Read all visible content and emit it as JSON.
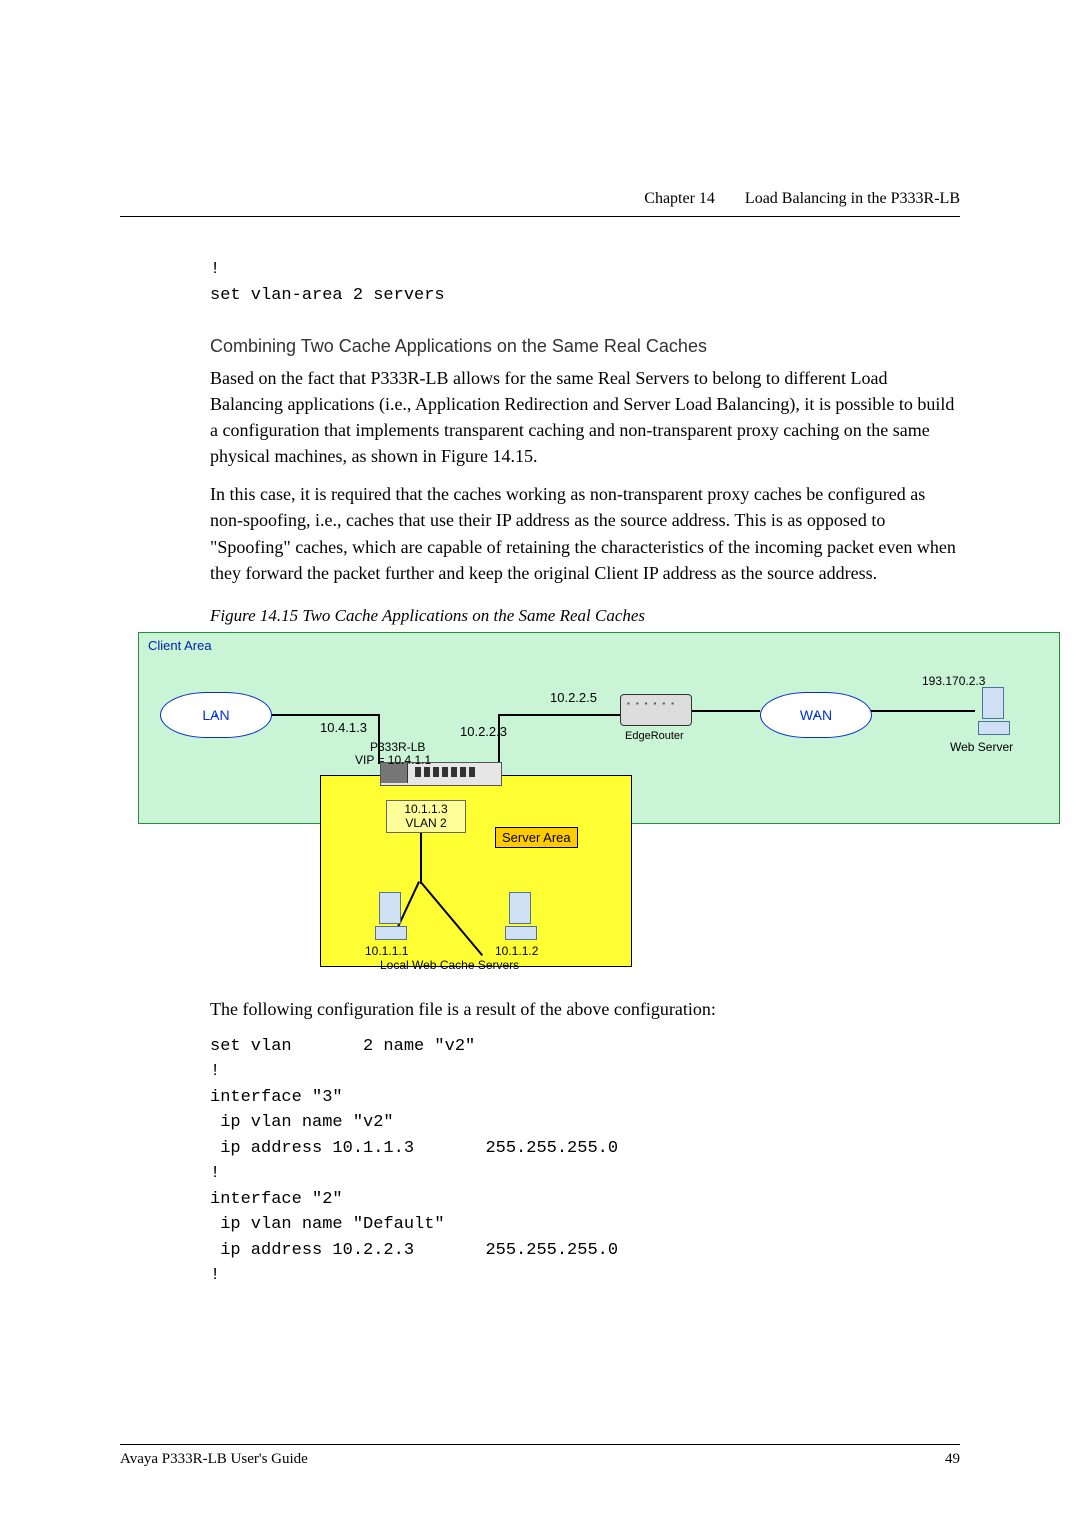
{
  "header": {
    "chapter": "Chapter 14",
    "title": "Load Balancing in the P333R-LB"
  },
  "code_top": "!\nset vlan-area 2 servers",
  "subheading": "Combining Two Cache Applications on the Same Real Caches",
  "para1": "Based on the fact that P333R-LB allows for the same Real Servers to belong to different Load Balancing applications (i.e., Application Redirection and Server Load Balancing), it is possible to build a configuration that implements transparent caching and non-transparent proxy caching on the same physical machines, as shown in Figure 14.15.",
  "para2": "In this case, it is required that the caches working as non-transparent proxy caches be configured as non-spoofing, i.e., caches that use their IP address as the source address. This is as opposed to \"Spoofing\" caches, which are capable of retaining the characteristics of the incoming packet even when they forward the packet further and keep the original Client IP address as the source address.",
  "fig_caption": "Figure 14.15  Two Cache Applications on the Same Real Caches",
  "diagram": {
    "client_area": "Client Area",
    "lan": "LAN",
    "wan": "WAN",
    "ip_10225": "10.2.2.5",
    "ip_10413": "10.4.1.3",
    "ip_10223": "10.2.2.3",
    "edge_router": "EdgeRouter",
    "p333r": "P333R-LB",
    "vip": "VIP = 10.4.1.1",
    "vlan_ip": "10.1.1.3",
    "vlan2": "VLAN 2",
    "server_area": "Server Area",
    "cache1": "10.1.1.1",
    "cache2": "10.1.1.2",
    "caches_label": "Local Web Cache Servers",
    "webserver_ip": "193.170.2.3",
    "web_server": "Web Server"
  },
  "para3": "The following configuration file is a result of the above configuration:",
  "code_bottom": "set vlan       2 name \"v2\"\n!\ninterface \"3\"\n ip vlan name \"v2\"\n ip address 10.1.1.3       255.255.255.0\n!\ninterface \"2\"\n ip vlan name \"Default\"\n ip address 10.2.2.3       255.255.255.0\n!",
  "footer": {
    "left": "Avaya P333R-LB User's Guide",
    "right": "49"
  },
  "chart_data": {
    "type": "diagram",
    "description": "Network topology showing Client Area (green) containing LAN cloud, P333R-LB switch (VIP 10.4.1.1, IPs 10.4.1.3 and 10.2.2.3), EdgeRouter (10.2.2.5), WAN cloud, and remote Web Server (193.170.2.3). Server Area (yellow) below contains VLAN 2 (10.1.1.3) connected to two Local Web Cache Servers at 10.1.1.1 and 10.1.1.2."
  }
}
